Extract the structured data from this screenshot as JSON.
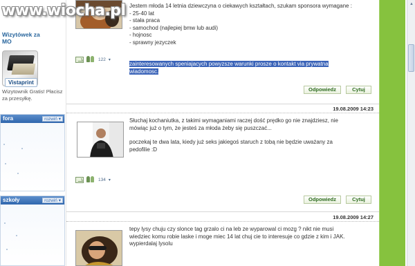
{
  "watermark": "www.wiocha.pl",
  "sidebar": {
    "promo_title_line1": "Wizytówek za",
    "promo_title_line2": "MO",
    "vistaprint": "Vistaprint",
    "promo_desc": "Wizytownik Gratis! Płacisz za przesyłkę.",
    "panels": [
      {
        "title": "fora",
        "toggle": "rozwiń ▾"
      },
      {
        "title": "szkoły",
        "toggle": "rozwiń ▾"
      }
    ]
  },
  "posts": [
    {
      "lines": [
        "Jestem młoda 14 letnia dziewczyna o ciekawych kształtach, szukam sponsora wymagane :",
        "- 25-40 lat",
        "- stała praca",
        "- samochod (najlepiej bmw lub audi)",
        "- hojnosc",
        "- sprawny jezyczek"
      ],
      "highlight_line1": "zainteresowanych speniajacych powyzsze warunki prosze o kontakt via prywatna",
      "highlight_line2": "wiadomosc.",
      "views": "122",
      "reply_label": "Odpowiedz",
      "quote_label": "Cytuj"
    },
    {
      "date": "19.08.2009 14:23",
      "lines": [
        "Słuchaj kochaniutka, z takimi wymaganiami raczej dość prędko go nie znajdziesz, nie",
        "mówiąc już o tym, że jesteś za młoda żeby się puszczać...",
        "poczekaj te dwa lata, kiedy już seks jakiegoś staruch z tobą nie będzie uważany za",
        "pedofilie :D"
      ],
      "views": "134",
      "reply_label": "Odpowiedz",
      "quote_label": "Cytuj"
    },
    {
      "date": "19.08.2009 14:27",
      "lines": [
        "tepy lysy chuju czy slonce tag grzalo ci na leb ze wyparowal ci mozg ? nikt nie musi",
        "wiedziec komu robie laske i moge miec 14 lat chuj cie to interesuje co gdzie z kim i JAK.",
        "wypierdalaj lysolu"
      ]
    }
  ],
  "colors": {
    "accent_green": "#86c23e",
    "highlight_blue": "#3a63b8",
    "panel_blue": "#2f66ad",
    "button_text": "#2d6b1e"
  }
}
